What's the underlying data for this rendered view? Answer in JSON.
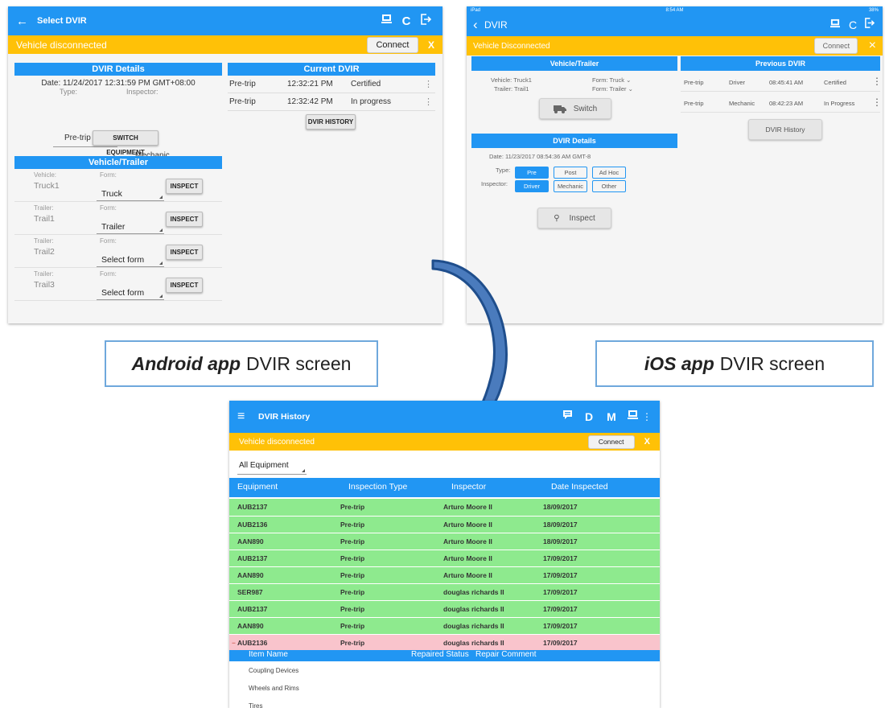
{
  "android": {
    "title": "Select DVIR",
    "back_icon": "←",
    "banner_text": "Vehicle disconnected",
    "connect_label": "Connect",
    "close_label": "X",
    "dvir_details": {
      "heading": "DVIR Details",
      "date": "Date: 11/24/2017 12:31:59 PM GMT+08:00",
      "type_label": "Type:",
      "inspector_label": "Inspector:",
      "type_value": "Pre-trip",
      "inspector_value": "Mechanic",
      "switch_label": "SWITCH EQUIPMENT"
    },
    "vehicle_trailer": {
      "heading": "Vehicle/Trailer",
      "rows": [
        {
          "kind": "Vehicle:",
          "name": "Truck1",
          "form_label": "Form:",
          "form": "Truck",
          "button": "INSPECT"
        },
        {
          "kind": "Trailer:",
          "name": "Trail1",
          "form_label": "Form:",
          "form": "Trailer",
          "button": "INSPECT"
        },
        {
          "kind": "Trailer:",
          "name": "Trail2",
          "form_label": "Form:",
          "form": "Select form",
          "button": "INSPECT"
        },
        {
          "kind": "Trailer:",
          "name": "Trail3",
          "form_label": "Form:",
          "form": "Select form",
          "button": "INSPECT"
        }
      ]
    },
    "current_dvir": {
      "heading": "Current DVIR",
      "rows": [
        {
          "type": "Pre-trip",
          "time": "12:32:21 PM",
          "status": "Certified"
        },
        {
          "type": "Pre-trip",
          "time": "12:32:42 PM",
          "status": "In progress"
        }
      ],
      "history_label": "DVIR HISTORY"
    }
  },
  "ios": {
    "status_left": "iPad",
    "status_time": "8:54 AM",
    "status_right": "38%",
    "title": "DVIR",
    "banner_text": "Vehicle Disconnected",
    "connect_label": "Connect",
    "close_label": "×",
    "vehicle_trailer": {
      "heading": "Vehicle/Trailer",
      "vehicle": "Vehicle: Truck1",
      "trailer": "Trailer: Trail1",
      "vehicle_form": "Form: Truck",
      "trailer_form": "Form: Trailer",
      "switch_label": "Switch"
    },
    "dvir_details": {
      "heading": "DVIR Details",
      "date": "Date: 11/23/2017 08:54:36 AM GMT-8",
      "type_label": "Type:",
      "types": [
        "Pre",
        "Post",
        "Ad Hoc"
      ],
      "inspector_label": "Inspector:",
      "inspectors": [
        "Driver",
        "Mechanic",
        "Other"
      ],
      "inspect_label": "Inspect"
    },
    "previous_dvir": {
      "heading": "Previous DVIR",
      "rows": [
        {
          "type": "Pre-trip",
          "inspector": "Driver",
          "time": "08:45:41 AM",
          "status": "Certified"
        },
        {
          "type": "Pre-trip",
          "inspector": "Mechanic",
          "time": "08:42:23 AM",
          "status": "In Progress"
        }
      ],
      "history_label": "DVIR History"
    }
  },
  "captions": {
    "android_bold": "Android app",
    "android_rest": "DVIR screen",
    "ios_bold": "iOS app",
    "ios_rest": "DVIR screen"
  },
  "history": {
    "title": "DVIR History",
    "menu_icon": "≡",
    "action_d": "D",
    "action_m": "M",
    "banner_text": "Vehicle disconnected",
    "connect_label": "Connect",
    "close_label": "X",
    "filter": "All Equipment",
    "columns": [
      "Equipment",
      "Inspection Type",
      "Inspector",
      "Date Inspected"
    ],
    "rows": [
      [
        "AUB2137",
        "Pre-trip",
        "Arturo Moore II",
        "18/09/2017"
      ],
      [
        "AUB2136",
        "Pre-trip",
        "Arturo Moore II",
        "18/09/2017"
      ],
      [
        "AAN890",
        "Pre-trip",
        "Arturo Moore II",
        "18/09/2017"
      ],
      [
        "AUB2137",
        "Pre-trip",
        "Arturo Moore II",
        "17/09/2017"
      ],
      [
        "AAN890",
        "Pre-trip",
        "Arturo Moore II",
        "17/09/2017"
      ],
      [
        "SER987",
        "Pre-trip",
        "douglas richards II",
        "17/09/2017"
      ],
      [
        "AUB2137",
        "Pre-trip",
        "douglas richards II",
        "17/09/2017"
      ],
      [
        "AAN890",
        "Pre-trip",
        "douglas richards II",
        "17/09/2017"
      ]
    ],
    "expanded_row": [
      "AUB2136",
      "Pre-trip",
      "douglas richards II",
      "17/09/2017"
    ],
    "expanded_marker": "−",
    "sub_columns": [
      "Item Name",
      "Repaired Status",
      "Repair Comment"
    ],
    "items": [
      "Coupling Devices",
      "Wheels and Rims",
      "Tires"
    ]
  },
  "colors": {
    "app_blue": "#2196f3",
    "banner_yellow": "#ffc107",
    "row_green": "#8eea8e",
    "row_pink": "#f9c4cc",
    "arrow_blue": "#1f4e8c"
  }
}
